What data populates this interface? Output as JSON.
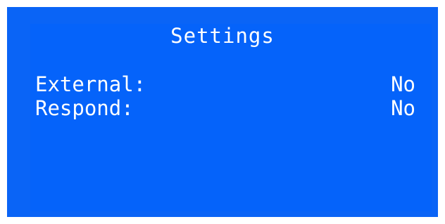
{
  "screen": {
    "title": "Settings",
    "rows": [
      {
        "label": "External:",
        "value": "No"
      },
      {
        "label": "Respond:",
        "value": "No"
      }
    ]
  },
  "colors": {
    "background": "#0563fa",
    "text": "#ffffff"
  }
}
